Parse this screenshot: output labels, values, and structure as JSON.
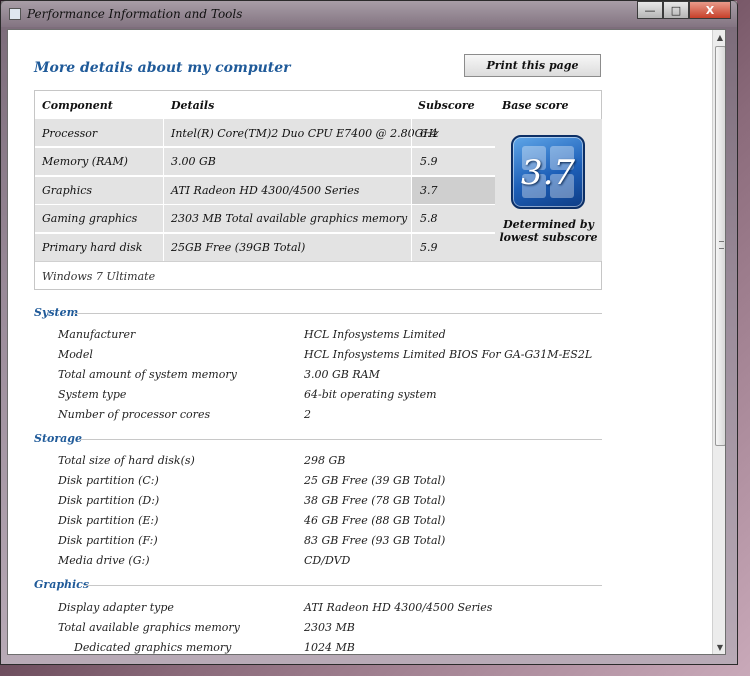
{
  "window": {
    "title": "Performance Information and Tools",
    "minimize_glyph": "—",
    "maximize_glyph": "□",
    "close_glyph": "X"
  },
  "page": {
    "heading": "More details about my computer",
    "print_label": "Print this page"
  },
  "score_table": {
    "headers": [
      "Component",
      "Details",
      "Subscore",
      "Base score"
    ],
    "rows": [
      {
        "component": "Processor",
        "details": "Intel(R) Core(TM)2 Duo CPU E7400 @ 2.80GHz",
        "subscore": "6.4"
      },
      {
        "component": "Memory (RAM)",
        "details": "3.00 GB",
        "subscore": "5.9"
      },
      {
        "component": "Graphics",
        "details": "ATI Radeon HD 4300/4500 Series",
        "subscore": "3.7"
      },
      {
        "component": "Gaming graphics",
        "details": "2303 MB Total available graphics memory",
        "subscore": "5.8"
      },
      {
        "component": "Primary hard disk",
        "details": "25GB Free (39GB Total)",
        "subscore": "5.9"
      }
    ],
    "base_score": "3.7",
    "base_caption_line1": "Determined by",
    "base_caption_line2": "lowest subscore",
    "os_edition": "Windows 7 Ultimate"
  },
  "sections": {
    "system": {
      "title": "System",
      "items": [
        {
          "key": "Manufacturer",
          "value": "HCL Infosystems Limited"
        },
        {
          "key": "Model",
          "value": "HCL Infosystems Limited BIOS For GA-G31M-ES2L"
        },
        {
          "key": "Total amount of system memory",
          "value": "3.00 GB RAM"
        },
        {
          "key": "System type",
          "value": "64-bit operating system"
        },
        {
          "key": "Number of processor cores",
          "value": "2"
        }
      ]
    },
    "storage": {
      "title": "Storage",
      "items": [
        {
          "key": "Total size of hard disk(s)",
          "value": "298 GB"
        },
        {
          "key": "Disk partition (C:)",
          "value": "25 GB Free (39 GB Total)"
        },
        {
          "key": "Disk partition (D:)",
          "value": "38 GB Free (78 GB Total)"
        },
        {
          "key": "Disk partition (E:)",
          "value": "46 GB Free (88 GB Total)"
        },
        {
          "key": "Disk partition (F:)",
          "value": "83 GB Free (93 GB Total)"
        },
        {
          "key": "Media drive (G:)",
          "value": "CD/DVD"
        }
      ]
    },
    "graphics": {
      "title": "Graphics",
      "items": [
        {
          "key": "Display adapter type",
          "value": "ATI Radeon HD 4300/4500 Series"
        },
        {
          "key": "Total available graphics memory",
          "value": "2303 MB"
        },
        {
          "key": "Dedicated graphics memory",
          "value": "1024 MB"
        }
      ]
    }
  },
  "colors": {
    "accent_blue": "#1f5a99",
    "row_shaded": "#e3e3e3",
    "lowest_highlight": "#d6d6d6"
  }
}
